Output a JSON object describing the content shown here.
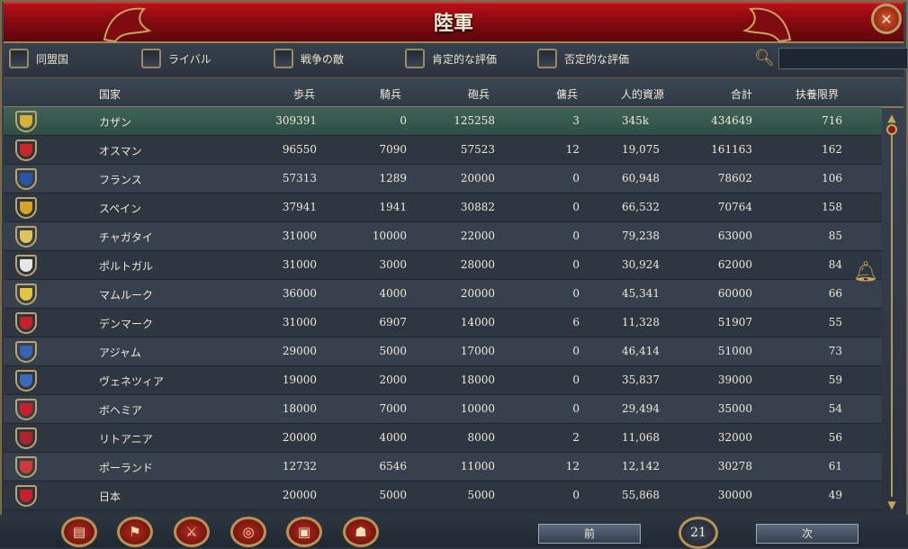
{
  "title": "陸軍",
  "filters": [
    {
      "label": "同盟国"
    },
    {
      "label": "ライバル"
    },
    {
      "label": "戦争の敵"
    },
    {
      "label": "肯定的な評価"
    },
    {
      "label": "否定的な評価"
    }
  ],
  "search": {
    "value": ""
  },
  "columns": {
    "country": "国家",
    "infantry": "歩兵",
    "cavalry": "騎兵",
    "artillery": "砲兵",
    "mercenaries": "傭兵",
    "manpower": "人的資源",
    "total": "合計",
    "force_limit": "扶養限界"
  },
  "rows": [
    {
      "country": "カザン",
      "infantry": "309391",
      "cavalry": "0",
      "artillery": "125258",
      "mercenaries": "3",
      "manpower": "345k",
      "total": "434649",
      "force_limit": "716",
      "flag": "#d8b13a",
      "selected": true
    },
    {
      "country": "オスマン",
      "infantry": "96550",
      "cavalry": "7090",
      "artillery": "57523",
      "mercenaries": "12",
      "manpower": "19,075",
      "total": "161163",
      "force_limit": "162",
      "flag": "#c9282a"
    },
    {
      "country": "フランス",
      "infantry": "57313",
      "cavalry": "1289",
      "artillery": "20000",
      "mercenaries": "0",
      "manpower": "60,948",
      "total": "78602",
      "force_limit": "106",
      "flag": "#2c54a8"
    },
    {
      "country": "スペイン",
      "infantry": "37941",
      "cavalry": "1941",
      "artillery": "30882",
      "mercenaries": "0",
      "manpower": "66,532",
      "total": "70764",
      "force_limit": "158",
      "flag": "#d6a323"
    },
    {
      "country": "チャガタイ",
      "infantry": "31000",
      "cavalry": "10000",
      "artillery": "22000",
      "mercenaries": "0",
      "manpower": "79,238",
      "total": "63000",
      "force_limit": "85",
      "flag": "#e0c35a"
    },
    {
      "country": "ポルトガル",
      "infantry": "31000",
      "cavalry": "3000",
      "artillery": "28000",
      "mercenaries": "0",
      "manpower": "30,924",
      "total": "62000",
      "force_limit": "84",
      "flag": "#e6e6e6"
    },
    {
      "country": "マムルーク",
      "infantry": "36000",
      "cavalry": "4000",
      "artillery": "20000",
      "mercenaries": "0",
      "manpower": "45,341",
      "total": "60000",
      "force_limit": "66",
      "flag": "#e0c542"
    },
    {
      "country": "デンマーク",
      "infantry": "31000",
      "cavalry": "6907",
      "artillery": "14000",
      "mercenaries": "6",
      "manpower": "11,328",
      "total": "51907",
      "force_limit": "55",
      "flag": "#c8202a"
    },
    {
      "country": "アジャム",
      "infantry": "29000",
      "cavalry": "5000",
      "artillery": "17000",
      "mercenaries": "0",
      "manpower": "46,414",
      "total": "51000",
      "force_limit": "73",
      "flag": "#3a64b0"
    },
    {
      "country": "ヴェネツィア",
      "infantry": "19000",
      "cavalry": "2000",
      "artillery": "18000",
      "mercenaries": "0",
      "manpower": "35,837",
      "total": "39000",
      "force_limit": "59",
      "flag": "#3a6ab8"
    },
    {
      "country": "ボヘミア",
      "infantry": "18000",
      "cavalry": "7000",
      "artillery": "10000",
      "mercenaries": "0",
      "manpower": "29,494",
      "total": "35000",
      "force_limit": "54",
      "flag": "#c8202a"
    },
    {
      "country": "リトアニア",
      "infantry": "20000",
      "cavalry": "4000",
      "artillery": "8000",
      "mercenaries": "2",
      "manpower": "11,068",
      "total": "32000",
      "force_limit": "56",
      "flag": "#b0232a"
    },
    {
      "country": "ポーランド",
      "infantry": "12732",
      "cavalry": "6546",
      "artillery": "11000",
      "mercenaries": "12",
      "manpower": "12,142",
      "total": "30278",
      "force_limit": "61",
      "flag": "#d03a3a"
    },
    {
      "country": "日本",
      "infantry": "20000",
      "cavalry": "5000",
      "artillery": "5000",
      "mercenaries": "0",
      "manpower": "55,868",
      "total": "30000",
      "force_limit": "49",
      "flag": "#c8202a"
    }
  ],
  "pagination": {
    "prev": "前",
    "next": "次",
    "page": "21"
  },
  "bottom_tabs": [
    {
      "icon": "ledger-icon"
    },
    {
      "icon": "flag-icon"
    },
    {
      "icon": "crossed-swords-icon"
    },
    {
      "icon": "coins-icon"
    },
    {
      "icon": "crate-icon"
    },
    {
      "icon": "handshake-icon"
    }
  ]
}
